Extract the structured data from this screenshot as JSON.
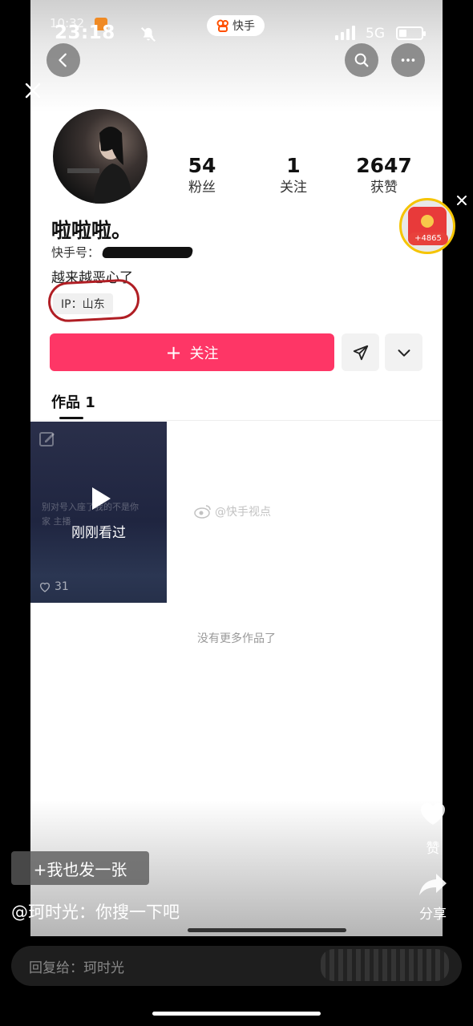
{
  "status_bar": {
    "time_bg": "10:32",
    "time": "23:18",
    "network": "5G",
    "battery": "39",
    "app_pill": "快手"
  },
  "profile": {
    "username": "啦啦啦。",
    "ks_id_label": "快手号：",
    "bio": "越来越恶心了",
    "ip": "IP：山东",
    "stats": [
      {
        "value": "54",
        "label": "粉丝"
      },
      {
        "value": "1",
        "label": "关注"
      },
      {
        "value": "2647",
        "label": "获赞"
      }
    ]
  },
  "actions": {
    "follow_label": "关注",
    "follow_plus": "+"
  },
  "tabs": {
    "works_label": "作品 1"
  },
  "video": {
    "watched_label": "刚刚看过",
    "likes": "31",
    "faint_text": "别对号入座了我的不是你家 主播"
  },
  "watermark": "@快手视点",
  "no_more": "没有更多作品了",
  "redpack": {
    "count": "+4865"
  },
  "overlay": {
    "post_too": "+我也发一张",
    "comment": "@珂时光：你搜一下吧",
    "side_like_label": "赞",
    "side_share_label": "分享",
    "reply_placeholder": "回复给：珂时光"
  },
  "colors": {
    "follow_button": "#fe3666",
    "ip_circle": "#b01e24",
    "redpack_ring": "#f5c400"
  }
}
